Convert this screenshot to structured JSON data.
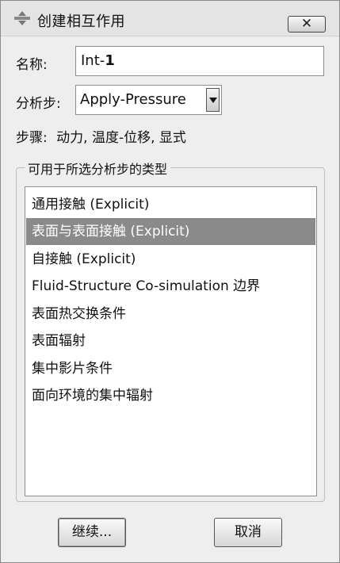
{
  "window": {
    "title": "创建相互作用",
    "close_symbol": "✕"
  },
  "name_field": {
    "label": "名称:",
    "value_prefix": "Int-",
    "value_suffix": "1"
  },
  "step": {
    "label": "分析步:",
    "selected": "Apply-Pressure"
  },
  "procedure": {
    "label": "步骤:",
    "value": "动力, 温度-位移, 显式"
  },
  "types_group": {
    "title": "可用于所选分析步的类型",
    "items": [
      {
        "label": "通用接触 (Explicit)"
      },
      {
        "label": "表面与表面接触 (Explicit)",
        "selected": true
      },
      {
        "label": "自接触 (Explicit)"
      },
      {
        "label": "Fluid-Structure Co-simulation 边界"
      },
      {
        "label": "表面热交换条件"
      },
      {
        "label": "表面辐射"
      },
      {
        "label": "集中影片条件"
      },
      {
        "label": "面向环境的集中辐射"
      }
    ]
  },
  "buttons": {
    "continue": "继续...",
    "cancel": "取消"
  },
  "icons": {
    "title": "interaction-icon",
    "close": "close-icon",
    "dropdown": "chevron-down-icon"
  },
  "colors": {
    "selection": "#8a8a8a",
    "window_bg": "#eeeeee"
  }
}
